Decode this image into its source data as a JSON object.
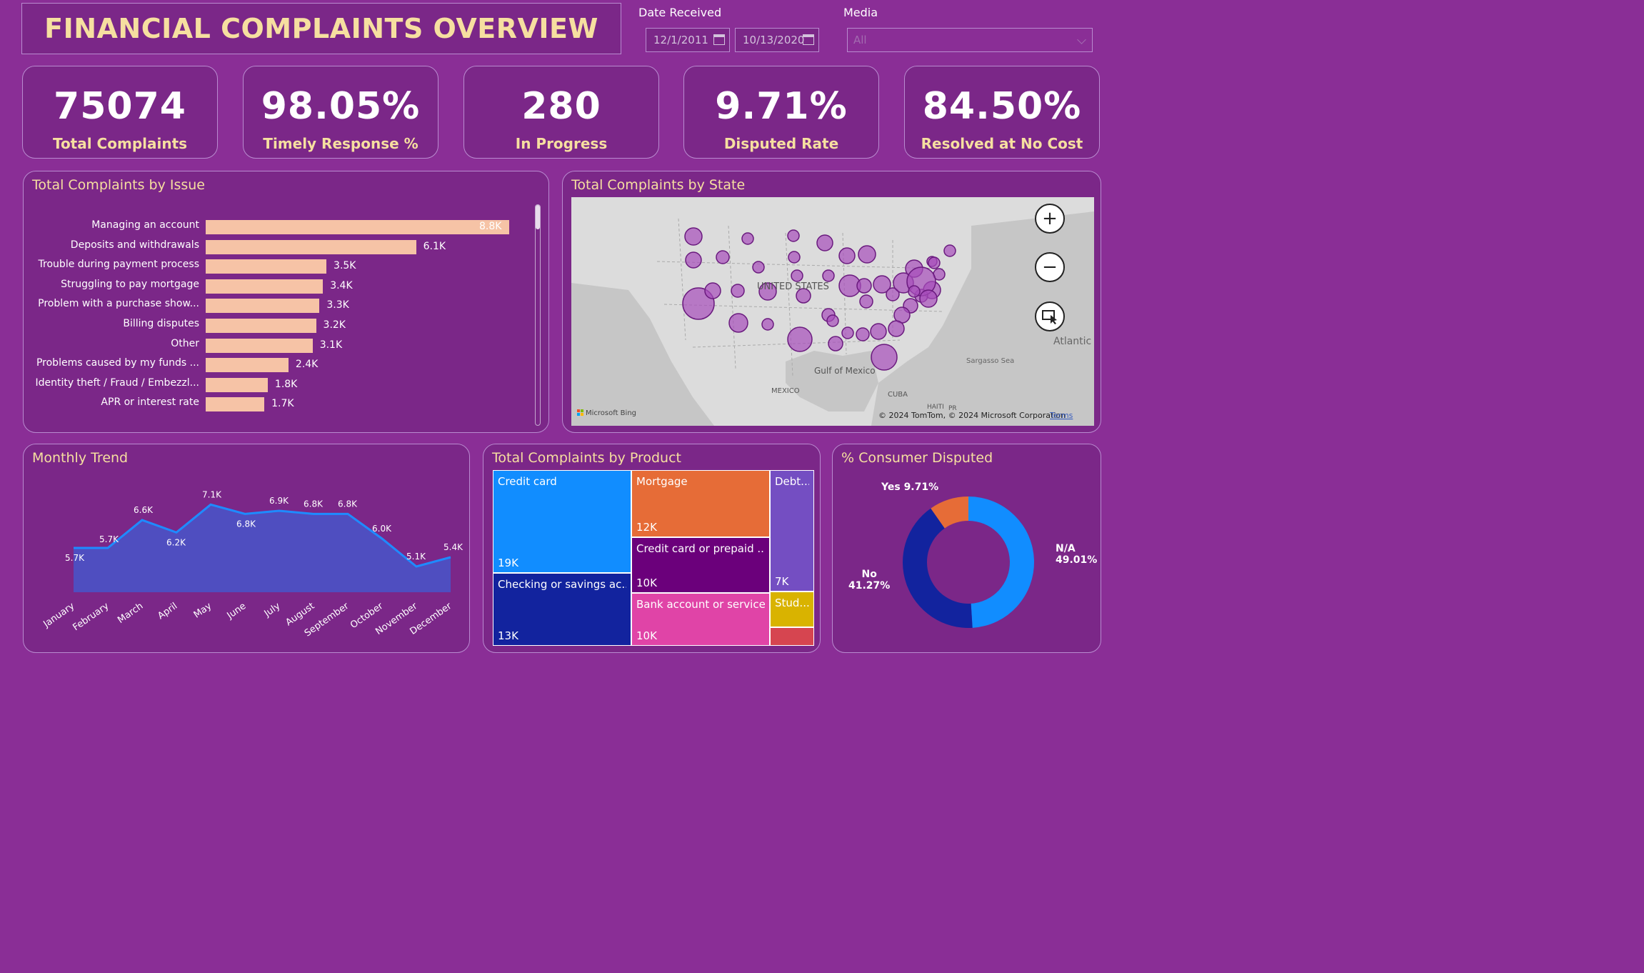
{
  "header": {
    "title": "FINANCIAL COMPLAINTS OVERVIEW"
  },
  "filters": {
    "date_label": "Date Received",
    "date_start": "12/1/2011",
    "date_end": "10/13/2020",
    "media_label": "Media",
    "media_value": "All"
  },
  "kpis": [
    {
      "value": "75074",
      "label": "Total Complaints"
    },
    {
      "value": "98.05%",
      "label": "Timely Response %"
    },
    {
      "value": "280",
      "label": "In Progress"
    },
    {
      "value": "9.71%",
      "label": "Disputed Rate"
    },
    {
      "value": "84.50%",
      "label": "Resolved at No Cost"
    }
  ],
  "issue_panel": {
    "title": "Total Complaints by Issue"
  },
  "state_panel": {
    "title": "Total Complaints by State",
    "map_labels": {
      "country": "UNITED STATES",
      "gulf": "Gulf of Mexico",
      "mexico": "MEXICO",
      "cuba": "CUBA",
      "haiti": "HAITI",
      "pr": "PR",
      "atlantic": "Atlantic",
      "sargasso": "Sargasso Sea",
      "bing": "Microsoft Bing",
      "copyright": "© 2024 TomTom, © 2024 Microsoft Corporation",
      "terms": "Terms"
    },
    "controls": [
      "zoom-in",
      "zoom-out",
      "select"
    ]
  },
  "trend_panel": {
    "title": "Monthly Trend"
  },
  "product_panel": {
    "title": "Total Complaints by Product"
  },
  "disputed_panel": {
    "title": "% Consumer Disputed"
  },
  "chart_data": [
    {
      "type": "bar",
      "title": "Total Complaints by Issue",
      "orientation": "horizontal",
      "categories": [
        "Managing an account",
        "Deposits and withdrawals",
        "Trouble during payment process",
        "Struggling to pay mortgage",
        "Problem with a purchase show...",
        "Billing disputes",
        "Other",
        "Problems caused by my funds ...",
        "Identity theft / Fraud / Embezzl...",
        "APR or interest rate"
      ],
      "values": [
        8800,
        6100,
        3500,
        3400,
        3300,
        3200,
        3100,
        2400,
        1800,
        1700
      ],
      "labels": [
        "8.8K",
        "6.1K",
        "3.5K",
        "3.4K",
        "3.3K",
        "3.2K",
        "3.1K",
        "2.4K",
        "1.8K",
        "1.7K"
      ],
      "color": "#f6c3a6"
    },
    {
      "type": "area",
      "title": "Monthly Trend",
      "categories": [
        "January",
        "February",
        "March",
        "April",
        "May",
        "June",
        "July",
        "August",
        "September",
        "October",
        "November",
        "December"
      ],
      "values": [
        5700,
        5700,
        6600,
        6200,
        7100,
        6800,
        6900,
        6800,
        6800,
        6000,
        5100,
        5400
      ],
      "labels": [
        "5.7K",
        "5.7K",
        "6.6K",
        "6.2K",
        "7.1K",
        "6.8K",
        "6.9K",
        "6.8K",
        "6.8K",
        "6.0K",
        "5.1K",
        "5.4K"
      ],
      "color": "#4f4ec0",
      "line_color": "#1e8bff"
    },
    {
      "type": "treemap",
      "title": "Total Complaints by Product",
      "items": [
        {
          "name": "Credit card",
          "value": 19000,
          "label": "19K",
          "color": "#118dff"
        },
        {
          "name": "Checking or savings ac...",
          "value": 13000,
          "label": "13K",
          "color": "#12239e"
        },
        {
          "name": "Mortgage",
          "value": 12000,
          "label": "12K",
          "color": "#e66c37"
        },
        {
          "name": "Credit card or prepaid ...",
          "value": 10000,
          "label": "10K",
          "color": "#6b007b"
        },
        {
          "name": "Bank account or service",
          "value": 10000,
          "label": "10K",
          "color": "#e044a7"
        },
        {
          "name": "Debt...",
          "value": 7000,
          "label": "7K",
          "color": "#744ec2"
        },
        {
          "name": "Stud...",
          "value": 3000,
          "label": "",
          "color": "#d9b300"
        },
        {
          "name": "",
          "value": 1500,
          "label": "",
          "color": "#d64550"
        }
      ]
    },
    {
      "type": "pie",
      "title": "% Consumer Disputed",
      "donut": true,
      "slices": [
        {
          "name": "N/A",
          "value": 49.01,
          "label": "49.01%",
          "color": "#118dff"
        },
        {
          "name": "No",
          "value": 41.27,
          "label": "41.27%",
          "color": "#12239e"
        },
        {
          "name": "Yes",
          "value": 9.71,
          "label": "9.71%",
          "color": "#e66c37"
        }
      ]
    }
  ]
}
